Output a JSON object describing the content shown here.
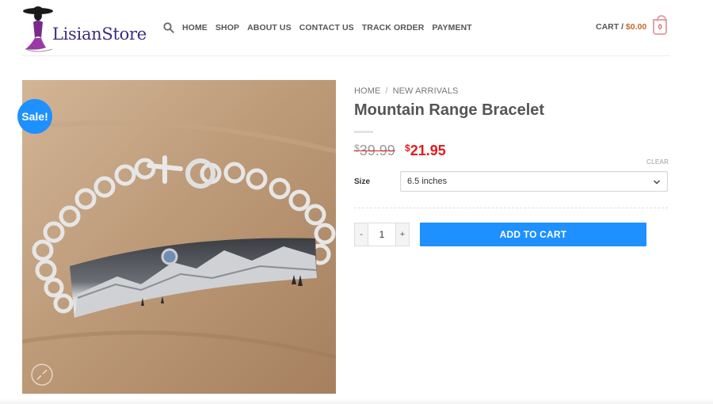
{
  "header": {
    "logo_text": "LisianStore",
    "nav": [
      "HOME",
      "SHOP",
      "ABOUT US",
      "CONTACT US",
      "TRACK ORDER",
      "PAYMENT"
    ],
    "cart_label": "CART /",
    "cart_amount": "$0.00",
    "cart_count": "0"
  },
  "product": {
    "sale_badge": "Sale!",
    "breadcrumb": [
      "HOME",
      "NEW ARRIVALS"
    ],
    "breadcrumb_sep": "/",
    "title": "Mountain Range Bracelet",
    "currency": "$",
    "old_price": "39.99",
    "new_price": "21.95",
    "clear_label": "CLEAR",
    "size_label": "Size",
    "size_value": "6.5 inches",
    "qty_minus": "-",
    "qty_value": "1",
    "qty_plus": "+",
    "add_to_cart": "ADD TO CART"
  },
  "colors": {
    "accent": "#1e90ff",
    "sale_price": "#e21b1b",
    "logo": "#3b2d84"
  },
  "icons": [
    "search-icon",
    "cart-icon",
    "zoom-icon",
    "chevron-down-icon"
  ]
}
